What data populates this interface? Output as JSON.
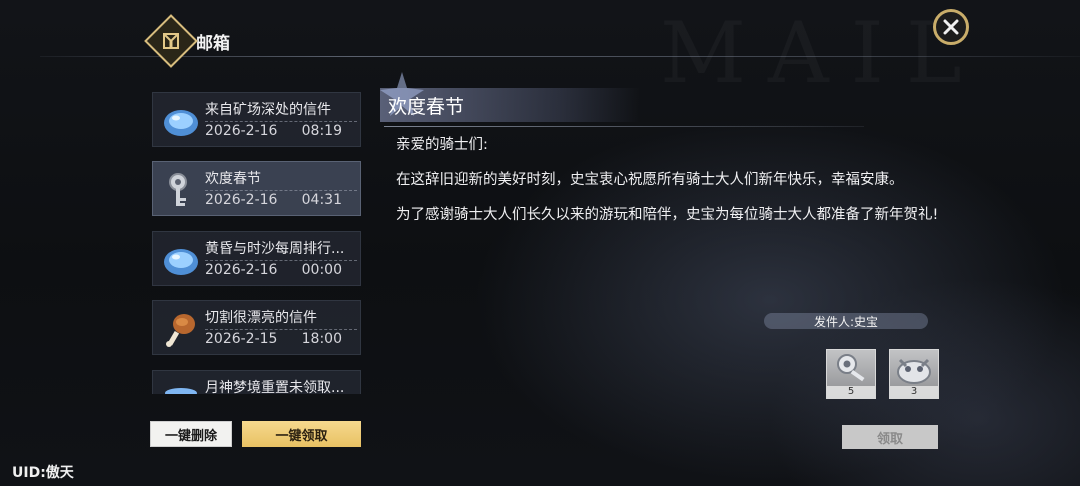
{
  "header": {
    "title": "邮箱",
    "watermark": "MAIL"
  },
  "mail_list": [
    {
      "subject": "来自矿场深处的信件",
      "date": "2026-2-16",
      "time": "08:19",
      "icon": "blue-orb-icon",
      "selected": false
    },
    {
      "subject": "欢度春节",
      "date": "2026-2-16",
      "time": "04:31",
      "icon": "silver-key-icon",
      "selected": true
    },
    {
      "subject": "黄昏与时沙每周排行...",
      "date": "2026-2-16",
      "time": "00:00",
      "icon": "blue-orb-icon",
      "selected": false
    },
    {
      "subject": "切割很漂亮的信件",
      "date": "2026-2-15",
      "time": "18:00",
      "icon": "drumstick-icon",
      "selected": false
    },
    {
      "subject": "月神梦境重置未领取...",
      "date": "",
      "time": "",
      "icon": "blue-bowl-icon",
      "selected": false
    }
  ],
  "buttons": {
    "delete_all": "一键删除",
    "claim_all": "一键领取",
    "claim": "领取"
  },
  "uid_label": "UID:傲天",
  "detail": {
    "title": "欢度春节",
    "greeting": "亲爱的骑士们:",
    "paragraph1": "在这辞旧迎新的美好时刻，史宝衷心祝愿所有骑士大人们新年快乐，幸福安康。",
    "paragraph2": "为了感谢骑士大人们长久以来的游玩和陪伴，史宝为每位骑士大人都准备了新年贺礼!",
    "sender": "发件人:史宝"
  },
  "rewards": [
    {
      "icon": "silver-key-icon",
      "count": "5"
    },
    {
      "icon": "silver-creature-icon",
      "count": "3"
    }
  ],
  "colors": {
    "accent_gold": "#e8c163",
    "frame_gold": "#c9ad6a",
    "selected_item": "#424a5c"
  }
}
